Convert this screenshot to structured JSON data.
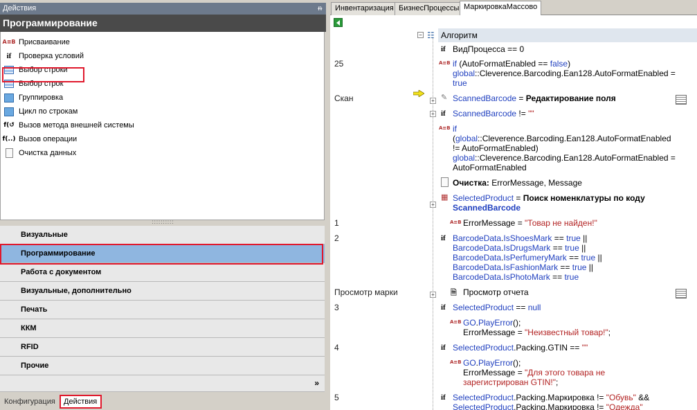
{
  "left_panel": {
    "title": "Действия",
    "pin": "ᵰ",
    "header": "Программирование",
    "tools": [
      {
        "label": "Присваивание",
        "icon": "assign-icon",
        "glyph": "A≡B"
      },
      {
        "label": "Проверка условий",
        "icon": "if-icon",
        "glyph": "if"
      },
      {
        "label": "Выбор строки",
        "icon": "table-icon",
        "glyph": ""
      },
      {
        "label": "Выбор строк",
        "icon": "table-icon",
        "glyph": ""
      },
      {
        "label": "Группировка",
        "icon": "group-icon",
        "glyph": ""
      },
      {
        "label": "Цикл по строкам",
        "icon": "loop-icon",
        "glyph": ""
      },
      {
        "label": "Вызов метода внешней системы",
        "icon": "external-method-icon",
        "glyph": "f(↺"
      },
      {
        "label": "Вызов операции",
        "icon": "operation-icon",
        "glyph": "f(..)"
      },
      {
        "label": "Очистка данных",
        "icon": "document-icon",
        "glyph": ""
      }
    ],
    "splitter": "::::::::::",
    "categories": [
      {
        "label": "Визуальные",
        "active": false
      },
      {
        "label": "Программирование",
        "active": true
      },
      {
        "label": "Работа с документом",
        "active": false
      },
      {
        "label": "Визуальные, дополнительно",
        "active": false
      },
      {
        "label": "Печать",
        "active": false
      },
      {
        "label": "ККМ",
        "active": false
      },
      {
        "label": "RFID",
        "active": false
      },
      {
        "label": "Прочие",
        "active": false
      }
    ],
    "more_chevron": "»",
    "bottom_tabs": {
      "config": "Конфигурация",
      "actions": "Действия"
    }
  },
  "right_panel": {
    "tabs": [
      "Инвентаризация",
      "БизнесПроцессы",
      "МаркировкаМассово"
    ],
    "algorithm_label": "Алгоритм",
    "colors": {
      "keyword": "#1f3fbf",
      "string": "#b22222",
      "header_bg": "#dfe6ee",
      "selection": "#8fb6e0",
      "highlight": "#e0182c"
    }
  }
}
